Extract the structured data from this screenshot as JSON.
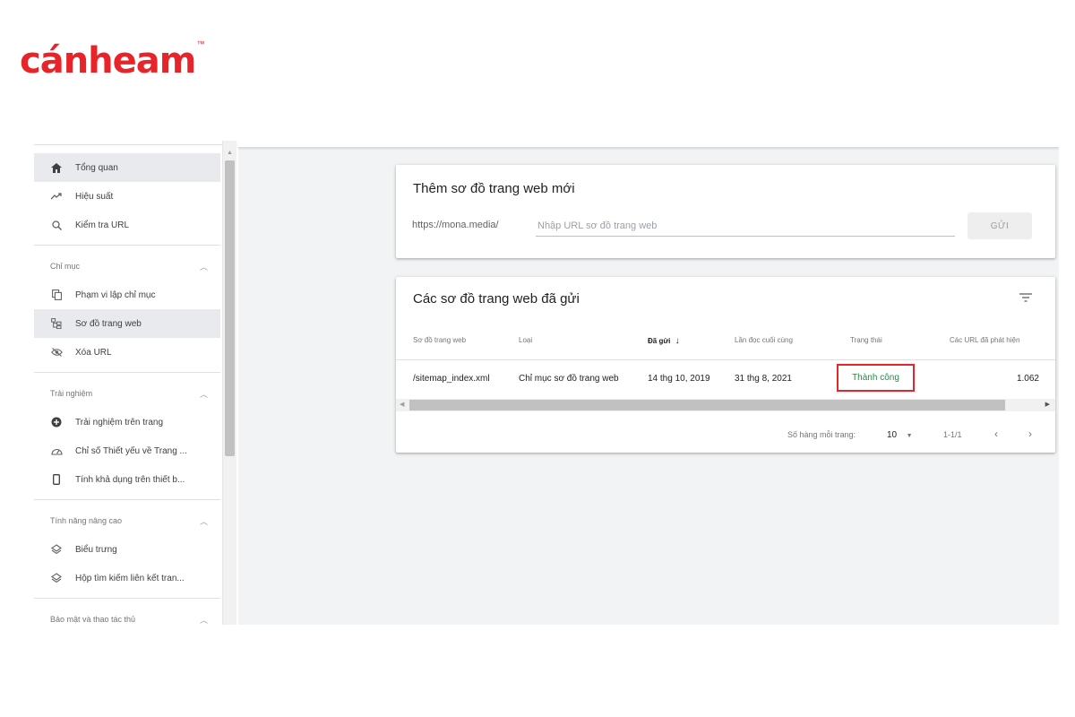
{
  "logo": {
    "text": "cánheam",
    "tm": "™"
  },
  "sidebar": {
    "items_top": [
      {
        "label": "Tổng quan",
        "icon": "home-icon"
      },
      {
        "label": "Hiệu suất",
        "icon": "trending-up-icon"
      },
      {
        "label": "Kiểm tra URL",
        "icon": "search-icon"
      }
    ],
    "sections": [
      {
        "title": "Chỉ mục",
        "items": [
          {
            "label": "Phạm vi lập chỉ mục",
            "icon": "copy-icon"
          },
          {
            "label": "Sơ đồ trang web",
            "icon": "sitemap-icon"
          },
          {
            "label": "Xóa URL",
            "icon": "visibility-off-icon"
          }
        ]
      },
      {
        "title": "Trải nghiệm",
        "items": [
          {
            "label": "Trải nghiệm trên trang",
            "icon": "add-circle-icon"
          },
          {
            "label": "Chỉ số Thiết yếu về Trang ...",
            "icon": "speed-icon"
          },
          {
            "label": "Tính khả dụng trên thiết b...",
            "icon": "phone-icon"
          }
        ]
      },
      {
        "title": "Tính năng nâng cao",
        "items": [
          {
            "label": "Biểu trưng",
            "icon": "layers-icon"
          },
          {
            "label": "Hộp tìm kiếm liên kết tran...",
            "icon": "layers-icon"
          }
        ]
      },
      {
        "title": "Bảo mật và thao tác thủ",
        "items": []
      }
    ]
  },
  "add_sitemap": {
    "title": "Thêm sơ đồ trang web mới",
    "prefix": "https://mona.media/",
    "placeholder": "Nhập URL sơ đồ trang web",
    "submit_label": "GỬI"
  },
  "submitted": {
    "title": "Các sơ đồ trang web đã gửi",
    "columns": [
      "Sơ đồ trang web",
      "Loại",
      "Đã gửi",
      "Lần đọc cuối cùng",
      "Trạng thái",
      "Các URL đã phát hiện"
    ],
    "sort_arrow": "↓",
    "rows": [
      {
        "sitemap": "/sitemap_index.xml",
        "type": "Chỉ mục sơ đồ trang web",
        "submitted": "14 thg 10, 2019",
        "last_read": "31 thg 8, 2021",
        "status": "Thành công",
        "discovered": "1.062"
      }
    ],
    "pagination": {
      "rows_per_page_label": "Số hàng mỗi trang:",
      "rows_per_page": "10",
      "range": "1-1/1"
    }
  },
  "colors": {
    "brand": "#e8242b",
    "success": "#1e8e3e",
    "highlight_box": "#e8242b"
  }
}
